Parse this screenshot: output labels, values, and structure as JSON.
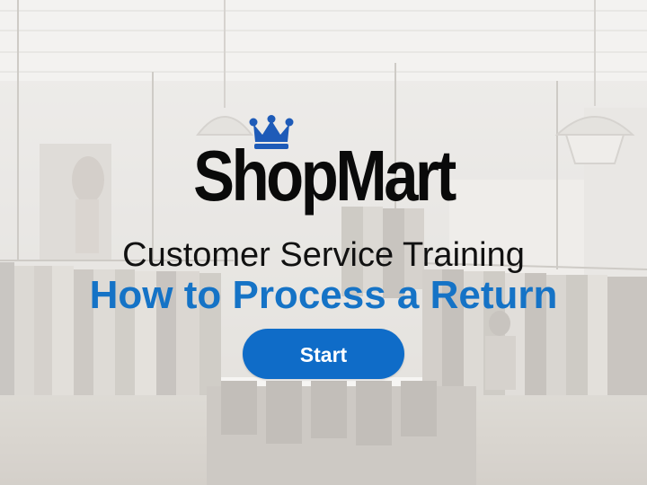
{
  "brand": {
    "logo_text": "ShopMart",
    "logo_icon": "crown-icon",
    "accent_color": "#1573c6",
    "crown_color": "#1e5bb8"
  },
  "slide": {
    "subtitle": "Customer Service Training",
    "title": "How to Process a Return"
  },
  "start_button": {
    "label": "Start",
    "color": "#0f6cc8"
  }
}
